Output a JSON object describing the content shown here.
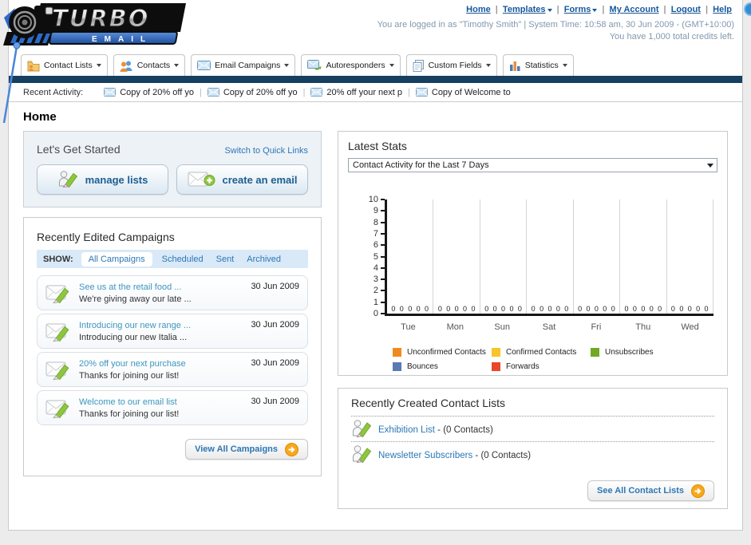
{
  "header": {
    "nav_links": [
      {
        "label": "Home",
        "dropdown": false
      },
      {
        "label": "Templates",
        "dropdown": true
      },
      {
        "label": "Forms",
        "dropdown": true
      },
      {
        "label": "My Account",
        "dropdown": false
      },
      {
        "label": "Logout",
        "dropdown": false
      },
      {
        "label": "Help",
        "dropdown": false
      }
    ],
    "login_text": "You are logged in as \"Timothy Smith\" | System Time: 10:58 am, 30 Jun 2009 - (GMT+10:00)",
    "credits_text": "You have 1,000 total credits left.",
    "logo_line1": "TURBO",
    "logo_line2": "EMAIL"
  },
  "tabs": [
    {
      "label": "Contact Lists",
      "icon": "contact-lists-icon"
    },
    {
      "label": "Contacts",
      "icon": "contacts-icon"
    },
    {
      "label": "Email Campaigns",
      "icon": "email-campaigns-icon"
    },
    {
      "label": "Autoresponders",
      "icon": "autoresponders-icon"
    },
    {
      "label": "Custom Fields",
      "icon": "custom-fields-icon"
    },
    {
      "label": "Statistics",
      "icon": "statistics-icon"
    }
  ],
  "recent_activity": {
    "label": "Recent Activity:",
    "items": [
      "Copy of 20% off yo",
      "Copy of 20% off yo",
      "20% off your next p",
      "Copy of Welcome to"
    ]
  },
  "page_title": "Home",
  "get_started": {
    "title": "Let's Get Started",
    "switch_link": "Switch to Quick Links",
    "buttons": [
      "manage lists",
      "create an email"
    ]
  },
  "campaigns": {
    "title": "Recently Edited Campaigns",
    "show_label": "SHOW:",
    "filters": [
      "All Campaigns",
      "Scheduled",
      "Sent",
      "Archived"
    ],
    "active_filter": "All Campaigns",
    "items": [
      {
        "title": "See us at the retail food ...",
        "subtitle": "We're giving away our late ...",
        "date": "30 Jun 2009"
      },
      {
        "title": "Introducing our new range ...",
        "subtitle": "Introducing our new Italia ...",
        "date": "30 Jun 2009"
      },
      {
        "title": "20% off your next purchase",
        "subtitle": "Thanks for joining our list!",
        "date": "30 Jun 2009"
      },
      {
        "title": "Welcome to our email list",
        "subtitle": "Thanks for joining our list!",
        "date": "30 Jun 2009"
      }
    ],
    "view_all": "View All Campaigns"
  },
  "stats": {
    "title": "Latest Stats",
    "dropdown_value": "Contact Activity for the Last 7 Days"
  },
  "chart_data": {
    "type": "bar",
    "title": "Contact Activity for the Last 7 Days",
    "categories": [
      "Tue",
      "Mon",
      "Sun",
      "Sat",
      "Fri",
      "Thu",
      "Wed"
    ],
    "series": [
      {
        "name": "Unconfirmed Contacts",
        "color": "#f18a1e",
        "values": [
          0,
          0,
          0,
          0,
          0,
          0,
          0
        ]
      },
      {
        "name": "Confirmed Contacts",
        "color": "#f7c52a",
        "values": [
          0,
          0,
          0,
          0,
          0,
          0,
          0
        ]
      },
      {
        "name": "Unsubscribes",
        "color": "#72a823",
        "values": [
          0,
          0,
          0,
          0,
          0,
          0,
          0
        ]
      },
      {
        "name": "Bounces",
        "color": "#5b79b2",
        "values": [
          0,
          0,
          0,
          0,
          0,
          0,
          0
        ]
      },
      {
        "name": "Forwards",
        "color": "#e8472b",
        "values": [
          0,
          0,
          0,
          0,
          0,
          0,
          0
        ]
      }
    ],
    "ylim": [
      0,
      10
    ],
    "yticks": [
      0,
      1,
      2,
      3,
      4,
      5,
      6,
      7,
      8,
      9,
      10
    ],
    "grid": "vertical",
    "legend_position": "bottom"
  },
  "contact_lists": {
    "title": "Recently Created Contact Lists",
    "items": [
      {
        "name": "Exhibition List",
        "suffix": " - (0 Contacts)"
      },
      {
        "name": "Newsletter Subscribers",
        "suffix": " - (0 Contacts)"
      }
    ],
    "see_all": "See All Contact Lists"
  }
}
